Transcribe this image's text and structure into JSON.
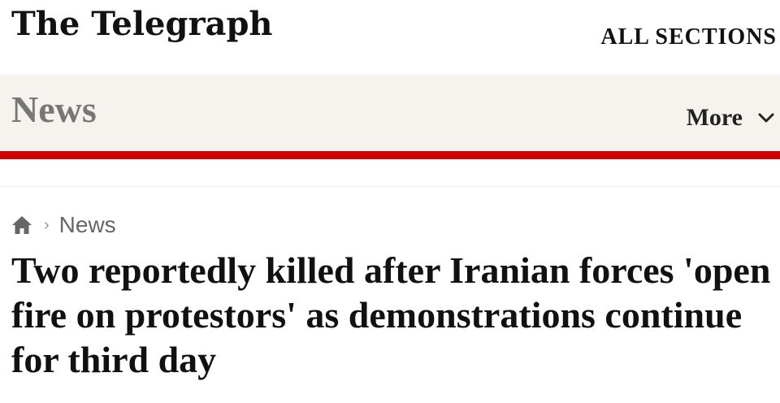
{
  "masthead": {
    "logo_text": "The Telegraph",
    "all_sections_label": "ALL SECTIONS"
  },
  "section_bar": {
    "section_name": "News",
    "more_label": "More"
  },
  "breadcrumb": {
    "home_icon": "home-icon",
    "separator": "›",
    "items": [
      "News"
    ]
  },
  "article": {
    "headline": "Two reportedly killed after Iranian forces 'open fire on protestors' as demonstrations continue for third day"
  },
  "colors": {
    "accent_red": "#cc0000",
    "section_bar_bg": "#f6f3ee",
    "section_name_grey": "#777777"
  }
}
